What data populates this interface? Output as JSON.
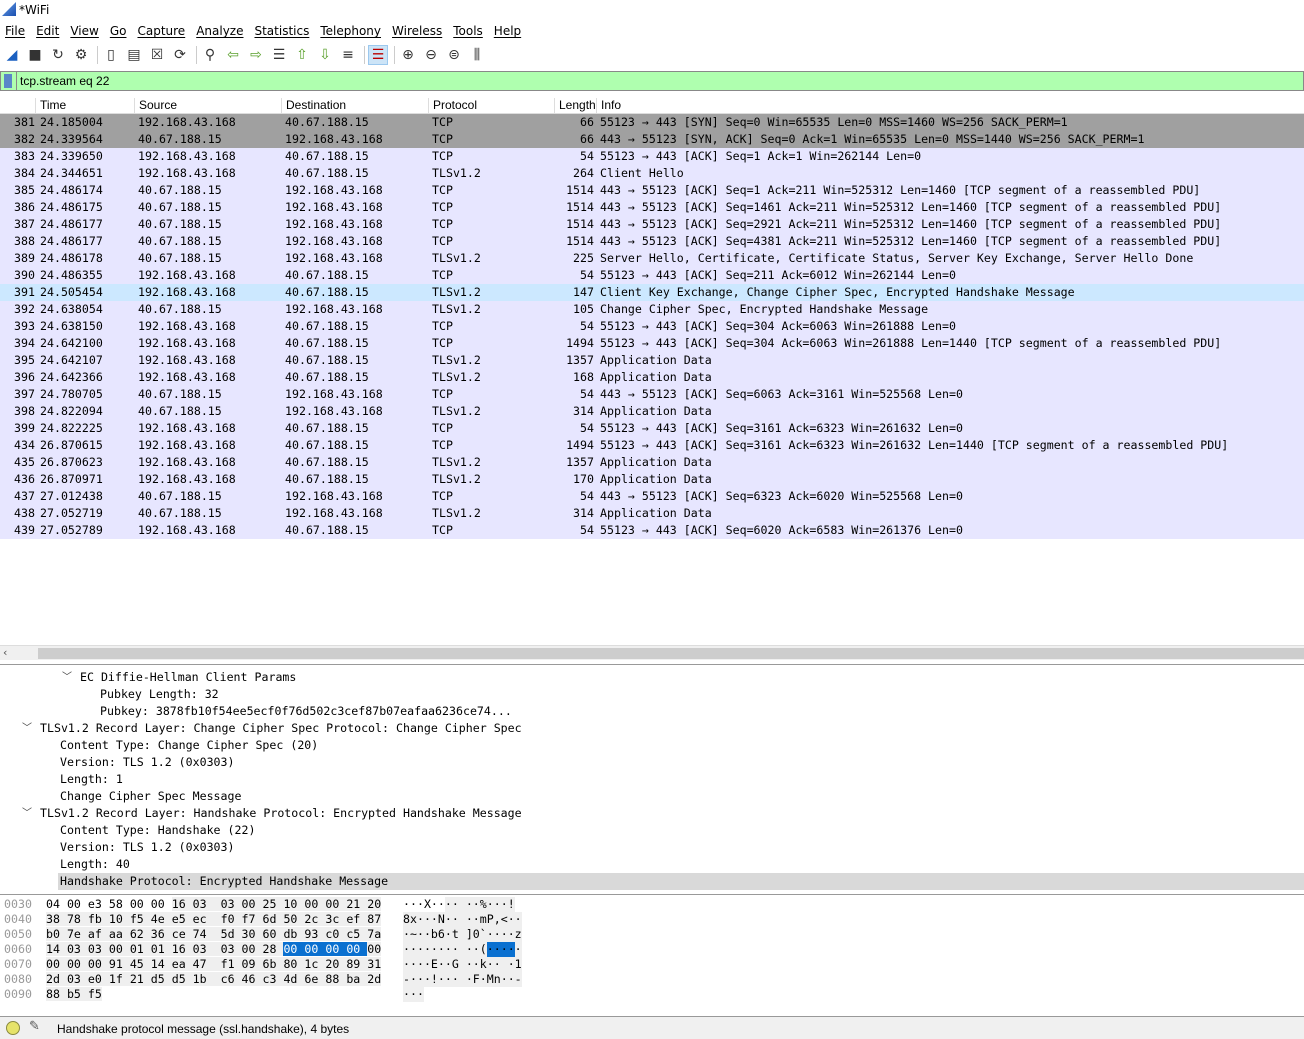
{
  "window": {
    "title": "*WiFi"
  },
  "menu": [
    "File",
    "Edit",
    "View",
    "Go",
    "Capture",
    "Analyze",
    "Statistics",
    "Telephony",
    "Wireless",
    "Tools",
    "Help"
  ],
  "toolbar": {
    "icons": [
      "shark-start-icon",
      "stop-icon",
      "restart-icon",
      "options-gear-icon",
      "|",
      "open-file-icon",
      "save-file-icon",
      "close-file-icon",
      "reload-icon",
      "|",
      "find-icon",
      "back-icon",
      "forward-icon",
      "go-to-packet-icon",
      "first-packet-icon",
      "last-packet-icon",
      "autoscroll-icon",
      "|",
      "colorize-icon",
      "|",
      "zoom-in-icon",
      "zoom-out-icon",
      "zoom-normal-icon",
      "resize-columns-icon"
    ]
  },
  "filter": {
    "value": "tcp.stream eq 22"
  },
  "columns": {
    "no": "",
    "time": "Time",
    "source": "Source",
    "destination": "Destination",
    "protocol": "Protocol",
    "length": "Length",
    "info": "Info"
  },
  "packets": [
    [
      "381",
      "24.185004",
      "192.168.43.168",
      "40.67.188.15",
      "TCP",
      "66",
      "55123 → 443 [SYN] Seq=0 Win=65535 Len=0 MSS=1460 WS=256 SACK_PERM=1",
      "syn"
    ],
    [
      "382",
      "24.339564",
      "40.67.188.15",
      "192.168.43.168",
      "TCP",
      "66",
      "443 → 55123 [SYN, ACK] Seq=0 Ack=1 Win=65535 Len=0 MSS=1440 WS=256 SACK_PERM=1",
      "syn"
    ],
    [
      "383",
      "24.339650",
      "192.168.43.168",
      "40.67.188.15",
      "TCP",
      "54",
      "55123 → 443 [ACK] Seq=1 Ack=1 Win=262144 Len=0",
      ""
    ],
    [
      "384",
      "24.344651",
      "192.168.43.168",
      "40.67.188.15",
      "TLSv1.2",
      "264",
      "Client Hello",
      ""
    ],
    [
      "385",
      "24.486174",
      "40.67.188.15",
      "192.168.43.168",
      "TCP",
      "1514",
      "443 → 55123 [ACK] Seq=1 Ack=211 Win=525312 Len=1460 [TCP segment of a reassembled PDU]",
      ""
    ],
    [
      "386",
      "24.486175",
      "40.67.188.15",
      "192.168.43.168",
      "TCP",
      "1514",
      "443 → 55123 [ACK] Seq=1461 Ack=211 Win=525312 Len=1460 [TCP segment of a reassembled PDU]",
      ""
    ],
    [
      "387",
      "24.486177",
      "40.67.188.15",
      "192.168.43.168",
      "TCP",
      "1514",
      "443 → 55123 [ACK] Seq=2921 Ack=211 Win=525312 Len=1460 [TCP segment of a reassembled PDU]",
      ""
    ],
    [
      "388",
      "24.486177",
      "40.67.188.15",
      "192.168.43.168",
      "TCP",
      "1514",
      "443 → 55123 [ACK] Seq=4381 Ack=211 Win=525312 Len=1460 [TCP segment of a reassembled PDU]",
      ""
    ],
    [
      "389",
      "24.486178",
      "40.67.188.15",
      "192.168.43.168",
      "TLSv1.2",
      "225",
      "Server Hello, Certificate, Certificate Status, Server Key Exchange, Server Hello Done",
      ""
    ],
    [
      "390",
      "24.486355",
      "192.168.43.168",
      "40.67.188.15",
      "TCP",
      "54",
      "55123 → 443 [ACK] Seq=211 Ack=6012 Win=262144 Len=0",
      ""
    ],
    [
      "391",
      "24.505454",
      "192.168.43.168",
      "40.67.188.15",
      "TLSv1.2",
      "147",
      "Client Key Exchange, Change Cipher Spec, Encrypted Handshake Message",
      "sel"
    ],
    [
      "392",
      "24.638054",
      "40.67.188.15",
      "192.168.43.168",
      "TLSv1.2",
      "105",
      "Change Cipher Spec, Encrypted Handshake Message",
      ""
    ],
    [
      "393",
      "24.638150",
      "192.168.43.168",
      "40.67.188.15",
      "TCP",
      "54",
      "55123 → 443 [ACK] Seq=304 Ack=6063 Win=261888 Len=0",
      ""
    ],
    [
      "394",
      "24.642100",
      "192.168.43.168",
      "40.67.188.15",
      "TCP",
      "1494",
      "55123 → 443 [ACK] Seq=304 Ack=6063 Win=261888 Len=1440 [TCP segment of a reassembled PDU]",
      ""
    ],
    [
      "395",
      "24.642107",
      "192.168.43.168",
      "40.67.188.15",
      "TLSv1.2",
      "1357",
      "Application Data",
      ""
    ],
    [
      "396",
      "24.642366",
      "192.168.43.168",
      "40.67.188.15",
      "TLSv1.2",
      "168",
      "Application Data",
      ""
    ],
    [
      "397",
      "24.780705",
      "40.67.188.15",
      "192.168.43.168",
      "TCP",
      "54",
      "443 → 55123 [ACK] Seq=6063 Ack=3161 Win=525568 Len=0",
      ""
    ],
    [
      "398",
      "24.822094",
      "40.67.188.15",
      "192.168.43.168",
      "TLSv1.2",
      "314",
      "Application Data",
      ""
    ],
    [
      "399",
      "24.822225",
      "192.168.43.168",
      "40.67.188.15",
      "TCP",
      "54",
      "55123 → 443 [ACK] Seq=3161 Ack=6323 Win=261632 Len=0",
      ""
    ],
    [
      "434",
      "26.870615",
      "192.168.43.168",
      "40.67.188.15",
      "TCP",
      "1494",
      "55123 → 443 [ACK] Seq=3161 Ack=6323 Win=261632 Len=1440 [TCP segment of a reassembled PDU]",
      ""
    ],
    [
      "435",
      "26.870623",
      "192.168.43.168",
      "40.67.188.15",
      "TLSv1.2",
      "1357",
      "Application Data",
      ""
    ],
    [
      "436",
      "26.870971",
      "192.168.43.168",
      "40.67.188.15",
      "TLSv1.2",
      "170",
      "Application Data",
      ""
    ],
    [
      "437",
      "27.012438",
      "40.67.188.15",
      "192.168.43.168",
      "TCP",
      "54",
      "443 → 55123 [ACK] Seq=6323 Ack=6020 Win=525568 Len=0",
      ""
    ],
    [
      "438",
      "27.052719",
      "40.67.188.15",
      "192.168.43.168",
      "TLSv1.2",
      "314",
      "Application Data",
      ""
    ],
    [
      "439",
      "27.052789",
      "192.168.43.168",
      "40.67.188.15",
      "TCP",
      "54",
      "55123 → 443 [ACK] Seq=6020 Ack=6583 Win=261376 Len=0",
      ""
    ]
  ],
  "details": [
    {
      "level": 2,
      "expanded": true,
      "text": "EC Diffie-Hellman Client Params"
    },
    {
      "level": 3,
      "text": "Pubkey Length: 32"
    },
    {
      "level": 3,
      "text": "Pubkey: 3878fb10f54ee5ecf0f76d502c3cef87b07eafaa6236ce74..."
    },
    {
      "level": 0,
      "expanded": true,
      "text": "TLSv1.2 Record Layer: Change Cipher Spec Protocol: Change Cipher Spec"
    },
    {
      "level": 1,
      "text": "Content Type: Change Cipher Spec (20)"
    },
    {
      "level": 1,
      "text": "Version: TLS 1.2 (0x0303)"
    },
    {
      "level": 1,
      "text": "Length: 1"
    },
    {
      "level": 1,
      "text": "Change Cipher Spec Message"
    },
    {
      "level": 0,
      "expanded": true,
      "text": "TLSv1.2 Record Layer: Handshake Protocol: Encrypted Handshake Message"
    },
    {
      "level": 1,
      "text": "Content Type: Handshake (22)"
    },
    {
      "level": 1,
      "text": "Version: TLS 1.2 (0x0303)"
    },
    {
      "level": 1,
      "text": "Length: 40"
    },
    {
      "level": 1,
      "text": "Handshake Protocol: Encrypted Handshake Message",
      "selected": true
    }
  ],
  "bytes": [
    {
      "offset": "0030",
      "hex": "04 00 e3 58 00 00 16 03 03 00 25 10 00 00 21 20",
      "ascii": "···X···· ··%···!"
    },
    {
      "offset": "0040",
      "hex": "38 78 fb 10 f5 4e e5 ec f0 f7 6d 50 2c 3c ef 87",
      "ascii": "8x···N·· ··mP,<··"
    },
    {
      "offset": "0050",
      "hex": "b0 7e af aa 62 36 ce 74 5d 30 60 db 93 c0 c5 7a",
      "ascii": "·~··b6·t ]0`····z"
    },
    {
      "offset": "0060",
      "hex": "14 03 03 00 01 01 16 03 03 00 28 00 00 00 00 00",
      "ascii": "········ ··(·····"
    },
    {
      "offset": "0070",
      "hex": "00 00 00 91 45 14 ea 47 f1 09 6b 80 1c 20 89 31",
      "ascii": "····E··G ··k·· ·1"
    },
    {
      "offset": "0080",
      "hex": "2d 03 e0 1f 21 d5 d5 1b c6 46 c3 4d 6e 88 ba 2d",
      "ascii": "-···!··· ·F·Mn··-"
    },
    {
      "offset": "0090",
      "hex": "88 b5 f5",
      "ascii": "···"
    }
  ],
  "status": {
    "message": "Handshake protocol message (ssl.handshake), 4 bytes",
    "led_color": "#e6e36a"
  },
  "colors": {
    "tcp_syn_row": "#a0a0a0",
    "tcp_row": "#e7e6ff",
    "selected_row": "#cce8ff",
    "filter_valid": "#afffaf",
    "byte_highlight": "#0a70d0"
  }
}
